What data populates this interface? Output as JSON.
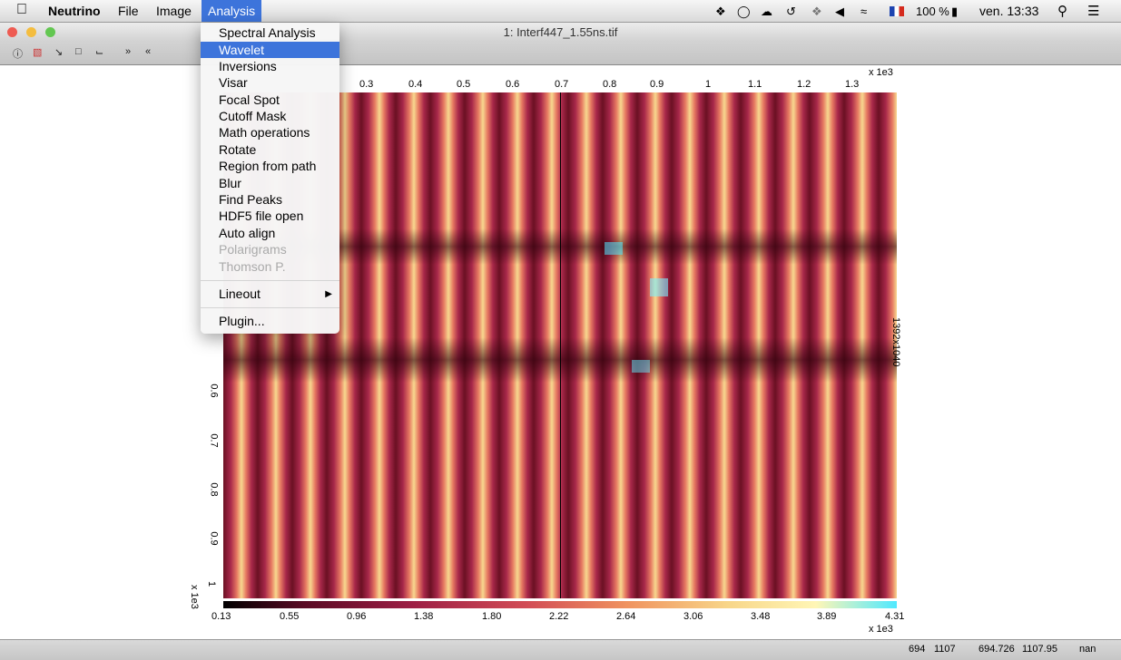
{
  "menubar": {
    "app_name": "Neutrino",
    "items": [
      "File",
      "Image",
      "Analysis"
    ],
    "tray": {
      "battery": "100 %",
      "clock": "ven. 13:33"
    }
  },
  "window": {
    "title": "1: Interf447_1.55ns.tif"
  },
  "analysis_menu": {
    "items": [
      {
        "label": "Spectral Analysis",
        "state": "normal"
      },
      {
        "label": "Wavelet",
        "state": "highlighted"
      },
      {
        "label": "Inversions",
        "state": "normal"
      },
      {
        "label": "Visar",
        "state": "normal"
      },
      {
        "label": "Focal Spot",
        "state": "normal"
      },
      {
        "label": "Cutoff Mask",
        "state": "normal"
      },
      {
        "label": "Math operations",
        "state": "normal"
      },
      {
        "label": "Rotate",
        "state": "normal"
      },
      {
        "label": "Region from path",
        "state": "normal"
      },
      {
        "label": "Blur",
        "state": "normal"
      },
      {
        "label": "Find Peaks",
        "state": "normal"
      },
      {
        "label": "HDF5 file open",
        "state": "normal"
      },
      {
        "label": "Auto align",
        "state": "normal"
      },
      {
        "label": "Polarigrams",
        "state": "disabled"
      },
      {
        "label": "Thomson P.",
        "state": "disabled"
      },
      {
        "label": "Lineout",
        "state": "submenu"
      },
      {
        "label": "Plugin...",
        "state": "normal"
      }
    ]
  },
  "plot": {
    "x_ticks": [
      "0.3",
      "0.4",
      "0.5",
      "0.6",
      "0.7",
      "0.8",
      "0.9",
      "1",
      "1.1",
      "1.2",
      "1.3"
    ],
    "x_multiplier": "x 1e3",
    "y_ticks": [
      "0.6",
      "0.7",
      "0.8",
      "0.9",
      "1"
    ],
    "y_multiplier": "x 1e3",
    "side_label": "1392x1040",
    "colorbar_ticks": [
      "0.13",
      "0.55",
      "0.96",
      "1.38",
      "1.80",
      "2.22",
      "2.64",
      "3.06",
      "3.48",
      "3.89",
      "4.31"
    ],
    "colorbar_multiplier": "x 1e3"
  },
  "statusbar": {
    "pixel_x": "694",
    "pixel_y": "1107",
    "coord_x": "694.726",
    "coord_y": "1107.95",
    "value": "nan"
  }
}
